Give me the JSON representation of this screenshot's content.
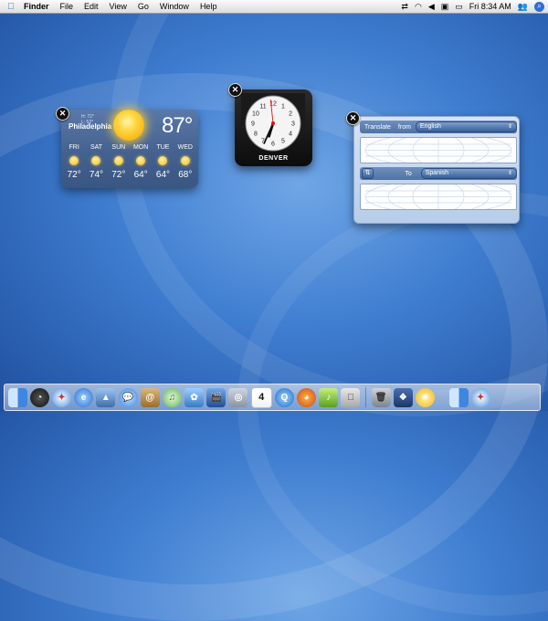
{
  "menubar": {
    "apple_icon": "apple-icon",
    "menus": [
      "Finder",
      "File",
      "Edit",
      "View",
      "Go",
      "Window",
      "Help"
    ],
    "clock": "Fri 8:34 AM",
    "status_icons": [
      "sync-arrows-icon",
      "wifi-icon",
      "volume-icon",
      "keyboard-icon",
      "battery-icon",
      "user-icon",
      "spotlight-icon"
    ]
  },
  "weather_widget": {
    "hi": "H: 72°",
    "lo": "L: 52°",
    "city": "Philadelphia",
    "temperature": "87°",
    "forecast": [
      {
        "day": "FRI",
        "temp": "72°"
      },
      {
        "day": "SAT",
        "temp": "74°"
      },
      {
        "day": "SUN",
        "temp": "72°"
      },
      {
        "day": "MON",
        "temp": "64°"
      },
      {
        "day": "TUE",
        "temp": "64°"
      },
      {
        "day": "WED",
        "temp": "68°"
      }
    ],
    "close": "✕"
  },
  "clock_widget": {
    "city": "DENVER",
    "time_shown": {
      "hour": 6,
      "minute": 34,
      "second": 59
    },
    "close": "✕"
  },
  "translate_widget": {
    "translate_label": "Translate",
    "from_label": "from",
    "from_language": "English",
    "to_label": "To",
    "to_language": "Spanish",
    "swap_symbol": "⇅",
    "close": "✕"
  },
  "dock": {
    "items": [
      "finder-icon",
      "dashboard-icon",
      "safari-icon",
      "internet-explorer-icon",
      "preview-icon",
      "ichat-icon",
      "address-book-icon",
      "itunes-icon",
      "iphoto-icon",
      "imovie-icon",
      "idvd-icon",
      "ical-icon",
      "quicktime-icon",
      "firefox-icon",
      "dreamweaver-icon",
      "apple-menu-icon",
      "trash-icon",
      "widgets-icon",
      "weather-icon",
      "finder-icon",
      "safari-icon"
    ]
  },
  "colors": {
    "desktop": "#3f7dd0",
    "menubar": "#eeeeee",
    "weather_widget": "#4a6797",
    "sun": "#ffd23a"
  }
}
